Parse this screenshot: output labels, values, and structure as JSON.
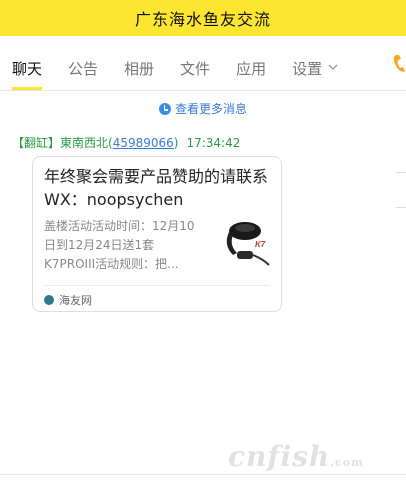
{
  "window": {
    "title": "广东海水鱼友交流"
  },
  "tabs": [
    {
      "label": "聊天",
      "active": true
    },
    {
      "label": "公告"
    },
    {
      "label": "相册"
    },
    {
      "label": "文件"
    },
    {
      "label": "应用"
    },
    {
      "label": "设置"
    }
  ],
  "chat": {
    "more_label": "查看更多消息",
    "message": {
      "sender_tag": "【翻缸】",
      "sender_name": "東南西北",
      "sender_id_open": "(",
      "sender_id": "45989066",
      "sender_id_close": ")",
      "time": "17:34:42",
      "card": {
        "title": "年终聚会需要产品赞助的请联系WX：noopsychen",
        "description": "盖楼活动活动时间：12月10日到12月24日送1套K7PROIII活动规则：把...",
        "source": "海友网"
      }
    }
  },
  "watermark": {
    "text": "cnfish",
    "suffix": ".com"
  },
  "colors": {
    "title_bar": "#fde631",
    "link": "#3a7bd5",
    "sender": "#2b9a46",
    "phone": "#f5a623"
  },
  "icons": [
    "phone-icon",
    "clock-icon",
    "chevron-down-icon",
    "source-icon"
  ]
}
